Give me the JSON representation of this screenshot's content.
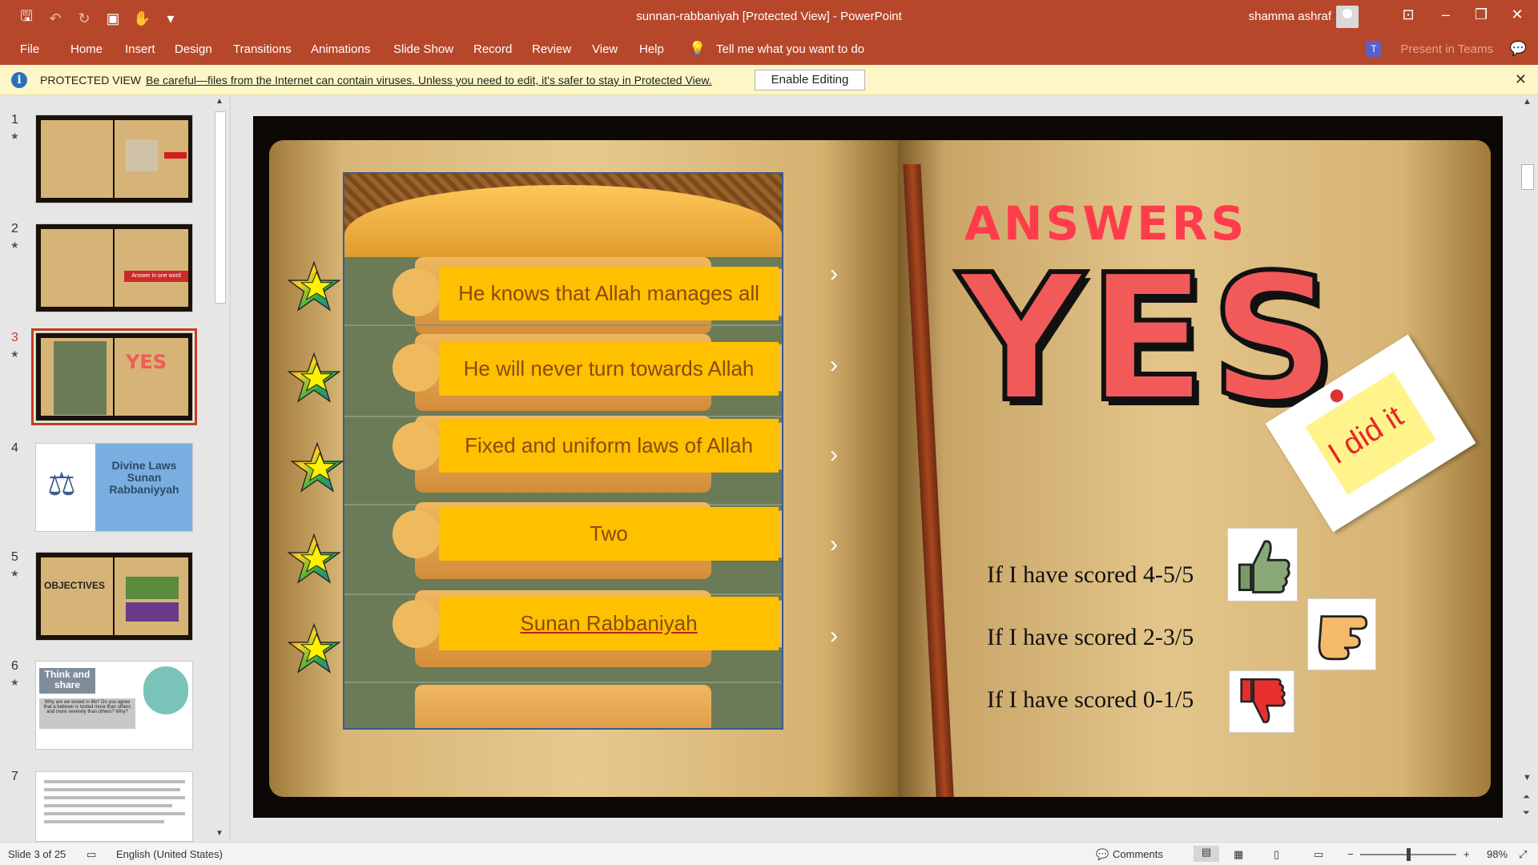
{
  "window": {
    "title": "sunnan-rabbaniyah [Protected View]  -  PowerPoint",
    "user": "shamma ashraf"
  },
  "ribbon": {
    "tabs": [
      "File",
      "Home",
      "Insert",
      "Design",
      "Transitions",
      "Animations",
      "Slide Show",
      "Record",
      "Review",
      "View",
      "Help"
    ],
    "tell_me": "Tell me what you want to do",
    "present_in_teams": "Present in Teams"
  },
  "protected_view": {
    "label": "PROTECTED VIEW",
    "message": "Be careful—files from the Internet can contain viruses. Unless you need to edit, it's safer to stay in Protected View.",
    "enable_button": "Enable Editing"
  },
  "thumbnails": [
    {
      "number": "1",
      "star": "★"
    },
    {
      "number": "2",
      "star": "★",
      "badge": "Answer in one word"
    },
    {
      "number": "3",
      "star": "★",
      "selected": true
    },
    {
      "number": "4",
      "title": "Divine Laws Sunan Rabbaniyyah"
    },
    {
      "number": "5",
      "star": "★",
      "title": "OBJECTIVES"
    },
    {
      "number": "6",
      "star": "★",
      "title": "Think and share",
      "subtitle": "Why are we tested in life? Do you agree that a believer is tested more than others and more severely than others? Why?"
    },
    {
      "number": "7"
    }
  ],
  "slide": {
    "answers_title": "ANSWERS",
    "yes_text": "YES",
    "note_text": "I did it",
    "answers": [
      "He knows that Allah manages all",
      "He will never turn towards Allah",
      "Fixed and uniform laws of Allah",
      "Two",
      "Sunan Rabbaniyah"
    ],
    "scores": [
      {
        "text": "If I have scored 4-5/5",
        "icon": "thumbs-up-icon"
      },
      {
        "text": "If I have scored 2-3/5",
        "icon": "thumb-sideways-icon"
      },
      {
        "text": "If I have scored 0-1/5",
        "icon": "thumbs-down-icon"
      }
    ]
  },
  "status": {
    "slide_info": "Slide 3 of 25",
    "language": "English (United States)",
    "comments": "Comments",
    "zoom": "98%"
  }
}
